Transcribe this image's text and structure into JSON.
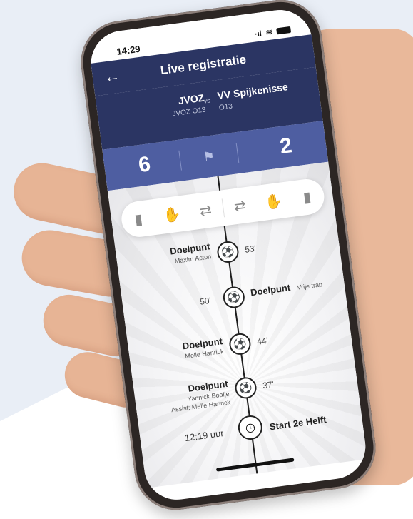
{
  "status": {
    "time": "14:29",
    "signal": "·ıl",
    "wifi": "≋"
  },
  "header": {
    "back_icon": "arrow-left-icon",
    "title": "Live registratie"
  },
  "match": {
    "home": {
      "name": "JVOZ",
      "sub": "JVOZ O13"
    },
    "vs": "vs",
    "away": {
      "name": "VV Spijkenisse",
      "sub": "O13"
    }
  },
  "score": {
    "home": "6",
    "away": "2"
  },
  "actions": {
    "left": [
      "card-icon",
      "substitute-icon",
      "swap-icon"
    ],
    "right": [
      "swap-icon",
      "substitute-icon",
      "card-icon"
    ]
  },
  "events": [
    {
      "label": "Doelpunt",
      "sub": "Maxim Acton",
      "minute": "53'"
    },
    {
      "label": "Doelpunt",
      "sub": "Vrije trap",
      "minute": "50'"
    },
    {
      "label": "Doelpunt",
      "sub": "Melle Hanrick",
      "minute": "44'"
    },
    {
      "label": "Doelpunt",
      "sub": "Yannick Boalje",
      "assist": "Assist: Melle Hanrick",
      "minute": "37'"
    }
  ],
  "footer": {
    "time": "12:19 uur",
    "label": "Start 2e Helft"
  },
  "colors": {
    "navy": "#2b3563",
    "score_bar": "#4e5ea1"
  }
}
